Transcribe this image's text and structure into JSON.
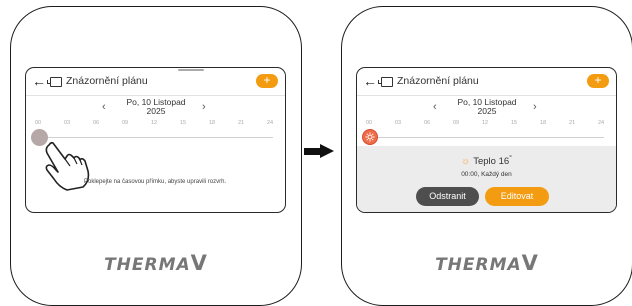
{
  "app": {
    "title": "Znázornění plánu",
    "add_label": "+",
    "date_line1": "Po, 10 Listopad",
    "date_line2": "2025",
    "prev_icon": "chevron-left-icon",
    "next_icon": "chevron-right-icon",
    "hours": [
      "00",
      "03",
      "06",
      "09",
      "12",
      "15",
      "18",
      "21",
      "24"
    ],
    "accent_color": "#f39c12"
  },
  "left_screen": {
    "hint": "Poklepejte na časovou přímku, abyste upravili rozvrh."
  },
  "right_screen": {
    "sun_symbol": "☼",
    "mode": "Teplo",
    "temp": "16",
    "temp_unit": "°",
    "schedule": "00:00, Každý den",
    "delete_label": "Odstranit",
    "edit_label": "Editovat"
  },
  "brand": {
    "text": "THERMA",
    "v": "V"
  }
}
